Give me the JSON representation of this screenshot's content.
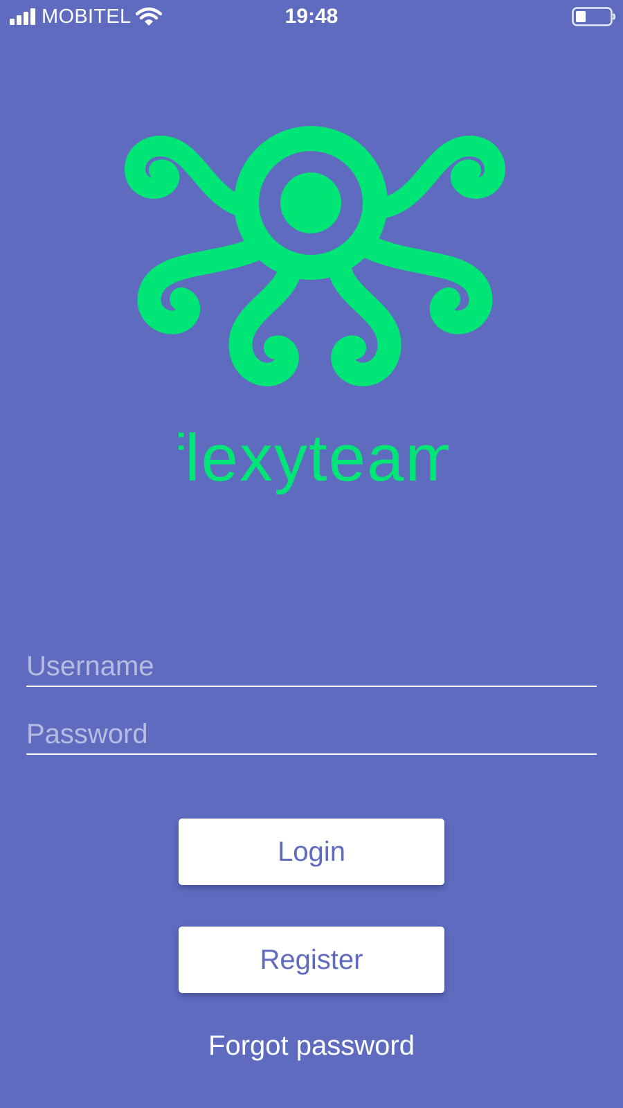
{
  "status_bar": {
    "carrier": "MOBITEL",
    "time": "19:48",
    "icons": [
      "signal-bars-icon",
      "wifi-icon",
      "battery-icon"
    ]
  },
  "brand": {
    "name": "flexyteam",
    "color": "#00e676",
    "background": "#5e6bbf",
    "icon": "octopus-logo"
  },
  "form": {
    "username_placeholder": "Username",
    "password_placeholder": "Password"
  },
  "actions": {
    "login_label": "Login",
    "register_label": "Register",
    "forgot_label": "Forgot password"
  }
}
